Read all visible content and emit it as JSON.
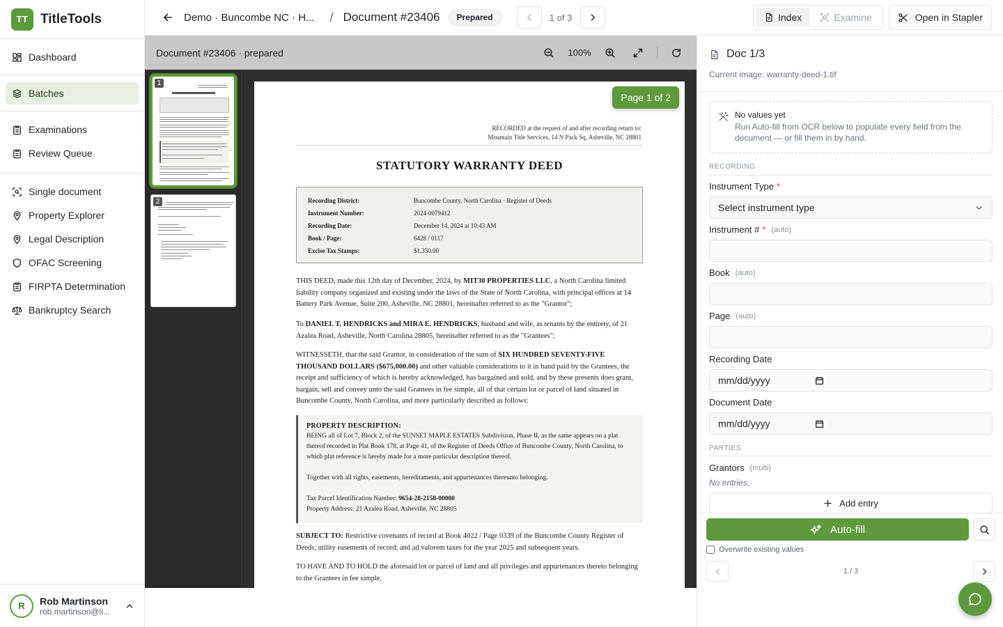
{
  "brand": {
    "logo": "TT",
    "name": "TitleTools"
  },
  "sidebar": {
    "group1": [
      {
        "label": "Dashboard",
        "icon": "dashboard-icon"
      }
    ],
    "group2": [
      {
        "label": "Batches",
        "icon": "layers-icon",
        "active": true
      }
    ],
    "group3": [
      {
        "label": "Examinations",
        "icon": "clipboard-icon"
      },
      {
        "label": "Review Queue",
        "icon": "clipboard-check-icon"
      }
    ],
    "group4": [
      {
        "label": "Single document",
        "icon": "scan-icon"
      },
      {
        "label": "Property Explorer",
        "icon": "map-pin-icon"
      },
      {
        "label": "Legal Description",
        "icon": "map-pin-icon"
      },
      {
        "label": "OFAC Screening",
        "icon": "shield-icon"
      },
      {
        "label": "FIRPTA Determination",
        "icon": "clipboard-icon"
      },
      {
        "label": "Bankruptcy Search",
        "icon": "scale-icon"
      }
    ]
  },
  "user": {
    "initial": "R",
    "name": "Rob Martinson",
    "email": "rob.martinson@li..."
  },
  "topbar": {
    "batch": "Demo · Buncombe NC · H...",
    "separator": "/",
    "document": "Document #23406",
    "status": "Prepared",
    "pager": "1 of 3",
    "tabs": [
      {
        "label": "Index",
        "active": true
      },
      {
        "label": "Examine",
        "active": false
      }
    ],
    "open_stapler": "Open in Stapler"
  },
  "viewer": {
    "title": "Document #23406 · prepared",
    "zoom": "100%",
    "page_badge": "Page 1 of 2",
    "thumbnails": [
      "1",
      "2"
    ]
  },
  "deed": {
    "rec_note_1": "RECORDED at the request of and after recording return to:",
    "rec_note_2": "Mountain Title Services, 14 N Pack Sq, Asheville, NC 28801",
    "title": "STATUTORY WARRANTY DEED",
    "records": [
      {
        "k": "Recording District:",
        "v": "Buncombe County, North Carolina · Register of Deeds"
      },
      {
        "k": "Instrument Number:",
        "v": "2024-0079412"
      },
      {
        "k": "Recording Date:",
        "v": "December 14, 2024 at 10:43 AM"
      },
      {
        "k": "Book / Page:",
        "v": "6428 / 0117"
      },
      {
        "k": "Excise Tax Stamps:",
        "v": "$1,350.00"
      }
    ],
    "p1_a": "THIS DEED, made this 12th day of December, 2024, by ",
    "p1_b": "MIT30 PROPERTIES LLC",
    "p1_c": ", a North Carolina limited liability company organized and existing under the laws of the State of North Carolina, with principal offices at 14 Battery Park Avenue, Suite 200, Asheville, NC 28801, hereinafter referred to as the \"Grantor\";",
    "p2_a": "To ",
    "p2_b": "DANIEL T. HENDRICKS and MIRA E. HENDRICKS",
    "p2_c": ", husband and wife, as tenants by the entirety, of 21 Azalea Road, Asheville, North Carolina 28805, hereinafter referred to as the \"Grantees\";",
    "p3_a": "WITNESSETH, that the said Grantor, in consideration of the sum of ",
    "p3_b": "SIX HUNDRED SEVENTY-FIVE THOUSAND DOLLARS ($675,000.00)",
    "p3_c": " and other valuable considerations to it in hand paid by the Grantees, the receipt and sufficiency of which is hereby acknowledged, has bargained and sold, and by these presents does grant, bargain, sell and convey unto the said Grantees in fee simple, all of that certain lot or parcel of land situated in Buncombe County, North Carolina, and more particularly described as follows:",
    "prop_heading": "PROPERTY DESCRIPTION:",
    "prop_1": "BEING all of Lot 7, Block 2, of the SUNSET MAPLE ESTATES Subdivision, Phase II, as the same appears on a plat thereof recorded in Plat Book 178, at Page 41, of the Register of Deeds Office of Buncombe County, North Carolina, to which plat reference is hereby made for a more particular description thereof.",
    "prop_2": "Together with all rights, easements, hereditaments, and appurtenances thereunto belonging.",
    "prop_3_a": "Tax Parcel Identification Number: ",
    "prop_3_b": "9654-28-2158-00000",
    "prop_4": "Property Address: 21 Azalea Road, Asheville, NC 28805",
    "p4_a": "SUBJECT TO:",
    "p4_b": " Restrictive covenants of record at Book 4022 / Page 0339 of the Buncombe County Register of Deeds; utility easements of record; and ad valorem taxes for the year 2025 and subsequent years.",
    "p5": "TO HAVE AND TO HOLD the aforesaid lot or parcel of land and all privileges and appurtenances thereto belonging to the Grantees in fee simple."
  },
  "panel": {
    "title": "Doc 1/3",
    "subtitle": "Current image: warranty-deed-1.tif",
    "empty_title": "No values yet",
    "empty_text": "Run Auto-fill from OCR below to populate every field from the document — or fill them in by hand.",
    "section_recording": "RECORDING",
    "instrument_type_label": "Instrument Type",
    "instrument_type_placeholder": "Select instrument type",
    "instrument_no_label": "Instrument #",
    "book_label": "Book",
    "page_label": "Page",
    "auto_hint": "(auto)",
    "required_mark": "*",
    "recording_date_label": "Recording Date",
    "document_date_label": "Document Date",
    "date_placeholder": "mm/dd/yyyy",
    "section_parties": "PARTIES",
    "grantors_label": "Grantors",
    "multi_hint": "(multi)",
    "no_entries": "No entries.",
    "add_entry": "Add entry",
    "autofill": "Auto-fill",
    "overwrite": "Overwrite existing values",
    "doc_pager": "1 / 3"
  },
  "colors": {
    "accent": "#5d9a3c",
    "accent_light": "#e6efe0"
  }
}
